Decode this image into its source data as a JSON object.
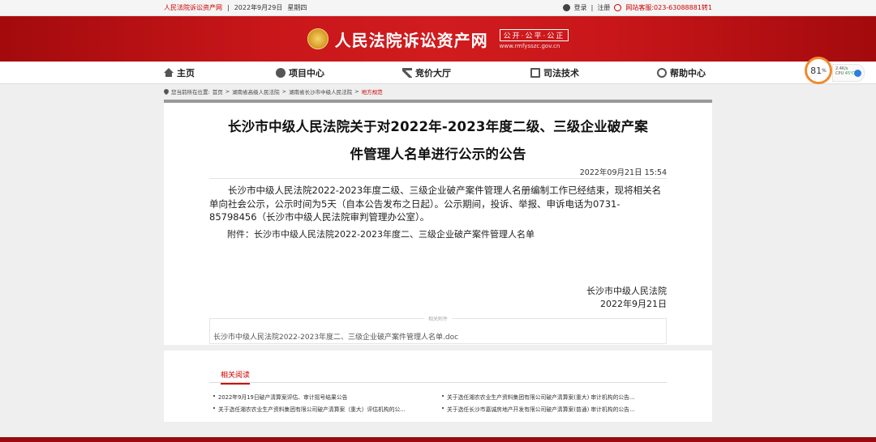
{
  "topbar": {
    "site_name": "人民法院诉讼资产网",
    "separator": "|",
    "date": "2022年9月29日",
    "weekday": "星期四",
    "login": "登录",
    "divider": "|",
    "register": "注册",
    "hotline": "网站客服:023-63088881转1"
  },
  "banner": {
    "title": "人民法院诉讼资产网",
    "slogan": "公开·公平·公正",
    "url": "www.rmfysszc.gov.cn"
  },
  "nav": {
    "items": [
      {
        "label": "主页",
        "icon": "home-icon"
      },
      {
        "label": "项目中心",
        "icon": "project-icon"
      },
      {
        "label": "竞价大厅",
        "icon": "auction-icon"
      },
      {
        "label": "司法技术",
        "icon": "tech-icon"
      },
      {
        "label": "帮助中心",
        "icon": "help-icon"
      }
    ]
  },
  "cpu_widget": {
    "percent": "81",
    "percent_unit": "%",
    "speed": "2.4K/s",
    "cpu_label": "CPU",
    "temp": "45℃"
  },
  "breadcrumb": {
    "prefix": "您当前所在位置:",
    "items": [
      "首页",
      ">",
      "湖南省高级人民法院",
      ">",
      "湖南省长沙市中级人民法院",
      ">"
    ],
    "current": "地方规范"
  },
  "article": {
    "title_line1": "长沙市中级人民法院关于对2022年-2023年度二级、三级企业破产案",
    "title_line2": "件管理人名单进行公示的公告",
    "date": "2022年09月21日 15:54",
    "body": "长沙市中级人民法院2022-2023年度二级、三级企业破产案件管理人名册编制工作已经结束，现将相关名单向社会公示，公示时间为5天（自本公告发布之日起）。公示期间，投诉、举报、申诉电话为0731-85798456（长沙市中级人民法院审判管理办公室）。",
    "annex": "附件：长沙市中级人民法院2022-2023年度二、三级企业破产案件管理人名单",
    "signature": "长沙市中级人民法院",
    "sign_date": "2022年9月21日",
    "attachment_title": "相关附件",
    "attachment_file": "长沙市中级人民法院2022-2023年度二、三级企业破产案件管理人名单.doc"
  },
  "related": {
    "tab": "相关阅读",
    "items": [
      "2022年9月19日破产清算案评估、审计摇号结果公告",
      "关于选任湘农农业生产资料集团有限公司破产清算案(重大) 审计机构的公告...",
      "关于选任湘农农业生产资料集团有限公司破产清算案（重大）评估机构的公...",
      "关于选任长沙市嘉诚房地产开发有限公司破产清算案(普通) 审计机构的公告..."
    ]
  }
}
